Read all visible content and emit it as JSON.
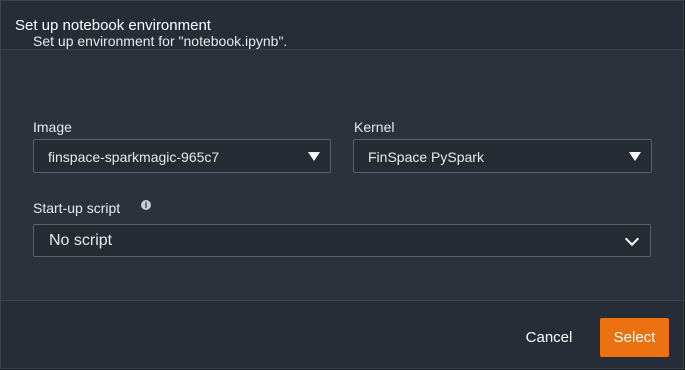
{
  "dialog": {
    "title": "Set up notebook environment",
    "intro": "Set up environment for \"notebook.ipynb\".",
    "image": {
      "label": "Image",
      "value": "finspace-sparkmagic-965c7"
    },
    "kernel": {
      "label": "Kernel",
      "value": "FinSpace PySpark"
    },
    "startup_script": {
      "label": "Start-up script",
      "value": "No script"
    },
    "buttons": {
      "cancel": "Cancel",
      "select": "Select"
    },
    "colors": {
      "primary_button": "#ec7211",
      "body_background": "#2b323b",
      "header_background": "#262d36"
    }
  }
}
